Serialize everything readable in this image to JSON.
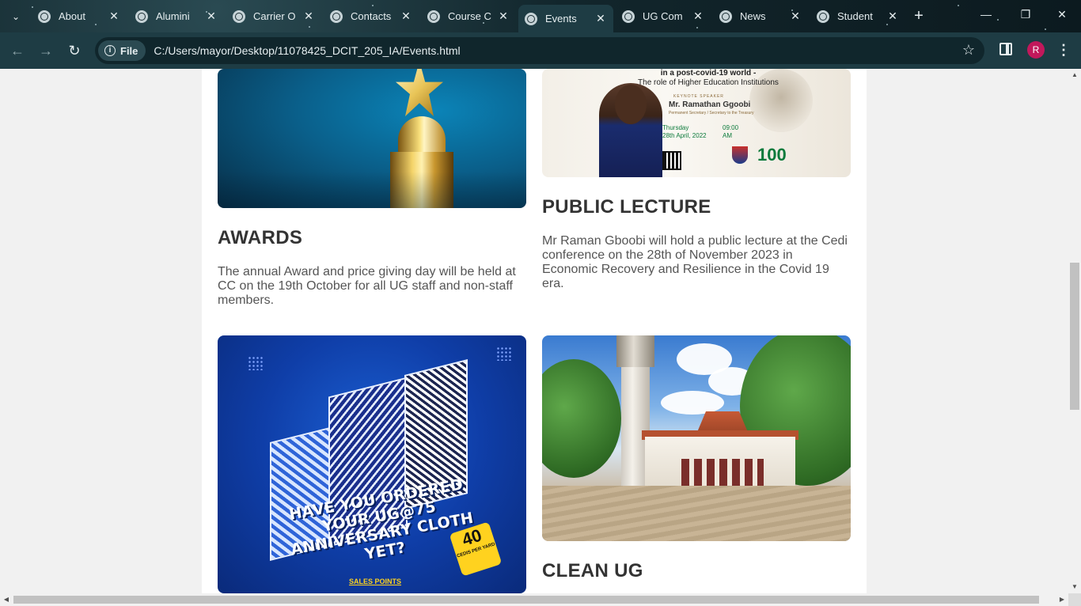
{
  "browser": {
    "tabs": [
      {
        "title": "About"
      },
      {
        "title": "Alumini"
      },
      {
        "title": "Carrier O"
      },
      {
        "title": "Contacts"
      },
      {
        "title": "Course C"
      },
      {
        "title": "Events"
      },
      {
        "title": "UG Com"
      },
      {
        "title": "News"
      },
      {
        "title": "Student"
      }
    ],
    "active_tab": "Events",
    "new_tab_symbol": "+",
    "close_symbol": "✕",
    "address": {
      "scheme_chip": "File",
      "url": "C:/Users/mayor/Desktop/11078425_DCIT_205_IA/Events.html"
    },
    "profile_initial": "R",
    "profile_color": "#c2185b",
    "icons": {
      "back": "arrow-left-icon",
      "forward": "arrow-right-icon",
      "reload": "reload-icon",
      "info": "info-icon",
      "bookmark": "star-icon",
      "side_panel": "side-panel-icon",
      "menu": "kebab-menu-icon",
      "tab_search": "chevron-down-icon",
      "minimize": "minimize-icon",
      "restore": "restore-icon",
      "close": "close-icon",
      "favicon": "globe-icon"
    }
  },
  "page": {
    "events": [
      {
        "title": "AWARDS",
        "description": "The annual Award and price giving day will be held at CC on the 19th October for all UG staff and non-staff members.",
        "image": "trophy"
      },
      {
        "title": "PUBLIC LECTURE",
        "description": "Mr Raman Gboobi will hold a public lecture at the Cedi conference on the 28th of November 2023 in Economic Recovery and Resilience in the Covid 19 era.",
        "image": "lecture-flyer",
        "flyer": {
          "heading_line1": "in a post-covid-19 world -",
          "heading_line2": "The role of Higher Education Institutions",
          "speaker_label": "KEYNOTE SPEAKER",
          "speaker": "Mr. Ramathan Ggoobi",
          "speaker_role": "Permanent Secretary / Secretary to the Treasury",
          "date_line1": "Thursday",
          "date_line2": "28th April, 2022",
          "time_line1": "09:00",
          "time_line2": "AM",
          "badge": "100"
        }
      },
      {
        "title": "",
        "description": "",
        "image": "anniversary-cloth",
        "flyer": {
          "slogan": "HAVE YOU ORDERED YOUR UG@75 ANNIVERSARY CLOTH YET?",
          "price": "40",
          "price_unit": "CEDIS PER YARD",
          "footer": "SALES POINTS"
        }
      },
      {
        "title": "CLEAN UG",
        "description": "",
        "image": "campus"
      }
    ]
  },
  "colors": {
    "chrome_dark": "#1e3c44",
    "page_bg": "#f1f1f1",
    "content_bg": "#ffffff",
    "heading": "#333333",
    "body_text": "#555555"
  }
}
